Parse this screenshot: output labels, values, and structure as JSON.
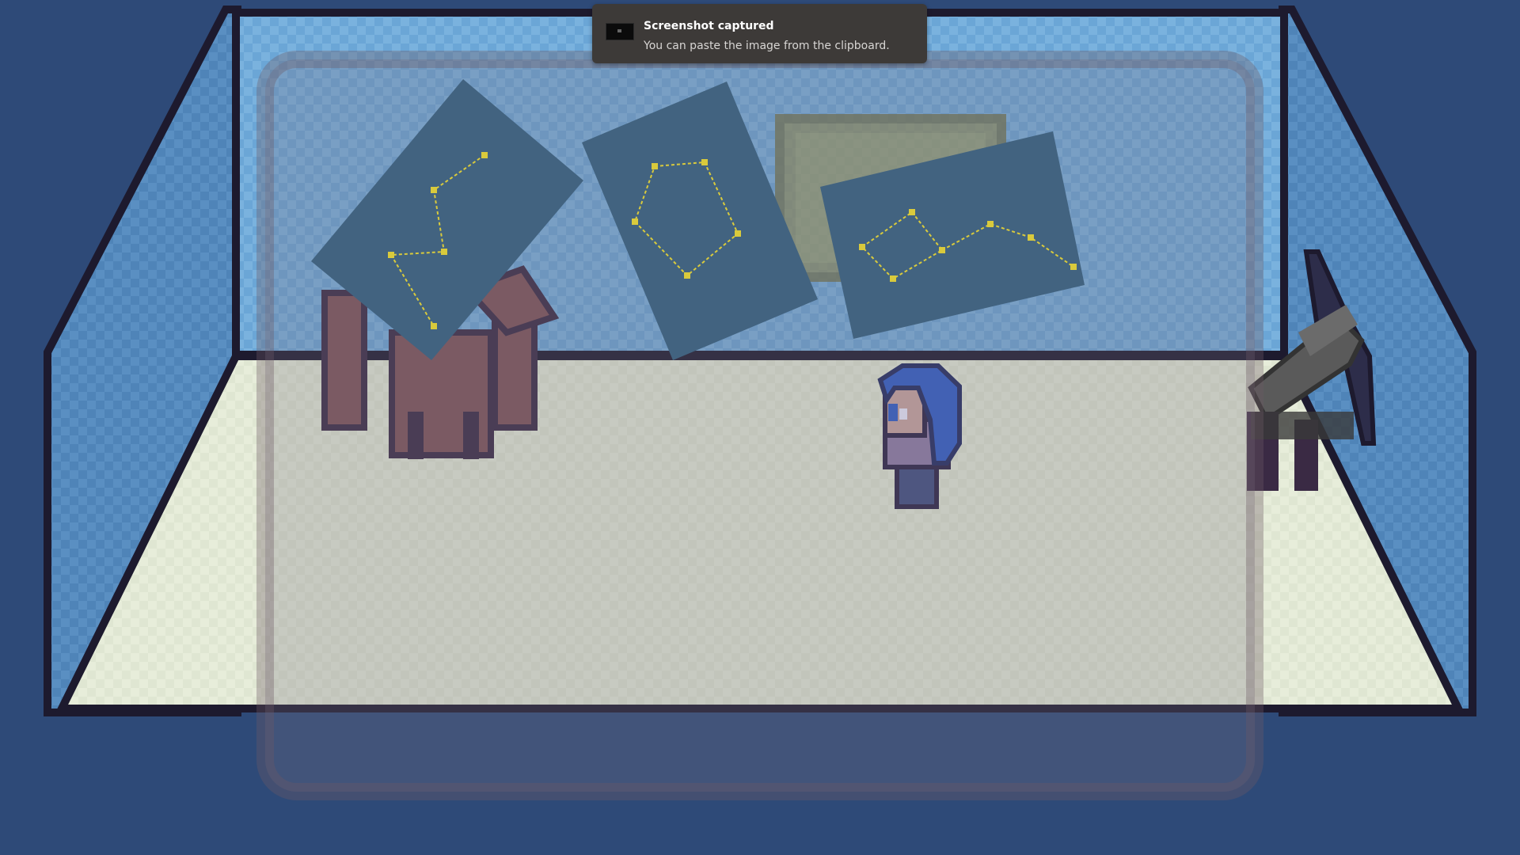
{
  "notification": {
    "title": "Screenshot captured",
    "body": "You can paste the image from the clipboard.",
    "thumbnail_icon": "screenshot-thumbnail-icon"
  },
  "scene": {
    "room": "observatory-room",
    "constellation_charts_count": 3,
    "objects": [
      "wooden-easel",
      "constellation-chart-zigzag",
      "constellation-chart-pentagon",
      "constellation-chart-line",
      "framed-painting",
      "blue-haired-character",
      "telescope"
    ],
    "colors": {
      "background": "#2e4a78",
      "wall": "#6aa3d4",
      "floor": "#dde3cf",
      "outline": "#1d1a2e",
      "chart_paper": "#2f5f80",
      "star": "#ffee22",
      "hair": "#2e5cc8",
      "easel": "#7a5057",
      "telescope": "#555555"
    }
  }
}
